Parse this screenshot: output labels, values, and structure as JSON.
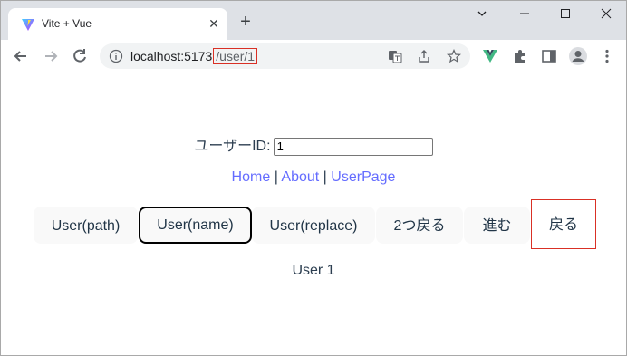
{
  "browser": {
    "tab_title": "Vite + Vue",
    "url_host": "localhost:5173",
    "url_path": "/user/1",
    "new_tab_symbol": "+",
    "close_symbol": "✕"
  },
  "page": {
    "user_id_label": "ユーザーID:",
    "user_id_value": "1",
    "links": [
      "Home",
      "About",
      "UserPage"
    ],
    "separator": "|",
    "buttons": [
      "User(path)",
      "User(name)",
      "User(replace)",
      "2つ戻る",
      "進む",
      "戻る"
    ],
    "result_text": "User 1"
  },
  "colors": {
    "link": "#646cff",
    "highlight_box": "#d93025",
    "vue_accent": "#42b883"
  }
}
